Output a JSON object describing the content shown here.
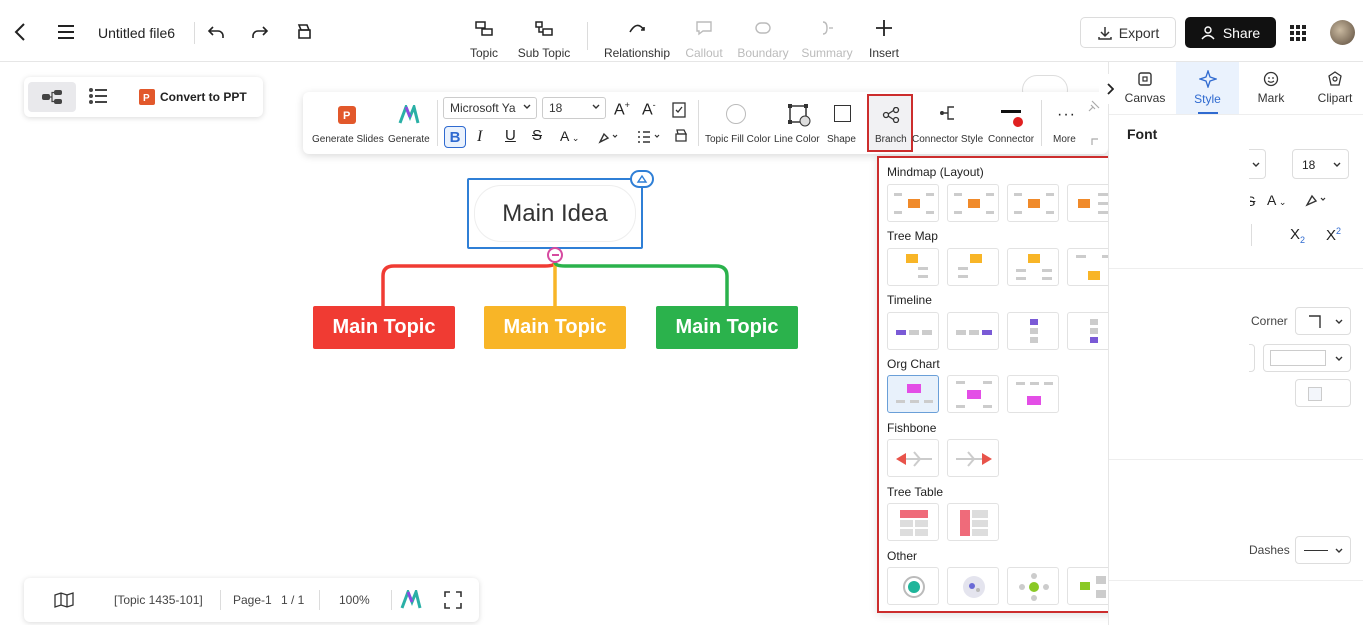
{
  "app": {
    "file_title": "Untitled file6"
  },
  "toolbar": {
    "topic": "Topic",
    "sub_topic": "Sub Topic",
    "relationship": "Relationship",
    "callout": "Callout",
    "boundary": "Boundary",
    "summary": "Summary",
    "insert": "Insert",
    "export": "Export",
    "share": "Share"
  },
  "view_switch": {
    "convert": "Convert to PPT"
  },
  "format_bar": {
    "generate_slides": "Generate Slides",
    "generate": "Generate",
    "font_family": "Microsoft Ya",
    "font_size": "18",
    "topic_fill_color": "Topic Fill Color",
    "line_color": "Line Color",
    "shape": "Shape",
    "branch": "Branch",
    "connector_style": "Connector Style",
    "connector": "Connector",
    "more": "More"
  },
  "canvas": {
    "main_idea": "Main Idea",
    "topics": [
      {
        "label": "Main Topic",
        "color": "#f03b33"
      },
      {
        "label": "Main Topic",
        "color": "#f8b527"
      },
      {
        "label": "Main Topic",
        "color": "#2bb24c"
      }
    ]
  },
  "branch_panel": {
    "sections": {
      "mindmap": "Mindmap (Layout)",
      "tree_map": "Tree Map",
      "timeline": "Timeline",
      "org_chart": "Org Chart",
      "fishbone": "Fishbone",
      "tree_table": "Tree Table",
      "other": "Other"
    }
  },
  "right_panel": {
    "tabs": [
      "Canvas",
      "Style",
      "Mark",
      "Clipart"
    ],
    "font_heading": "Font",
    "font_size": "18",
    "corner": "Corner",
    "dashes": "Dashes"
  },
  "status": {
    "topic_info": "[Topic 1435-101]",
    "page": "Page-1",
    "page_count": "1 / 1",
    "zoom": "100%"
  },
  "colors": {
    "accent": "#2f6ad0",
    "highlight_border": "#cc2d2d"
  }
}
